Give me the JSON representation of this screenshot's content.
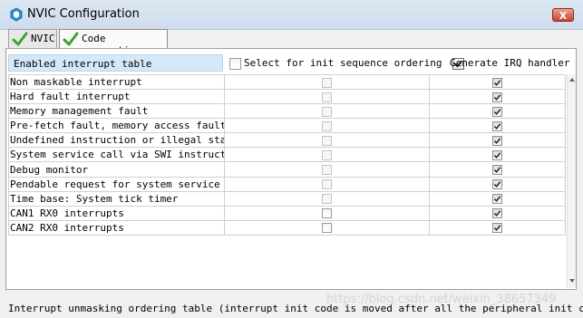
{
  "window": {
    "title": "NVIC Configuration",
    "close_label": "X"
  },
  "tabs": [
    {
      "label": "NVIC",
      "active": false
    },
    {
      "label": "Code generation",
      "active": true
    }
  ],
  "header": {
    "enabled_table_label": "Enabled interrupt table",
    "select_init_label": "Select for init sequence ordering",
    "select_init_checked": false,
    "generate_irq_label": "Generate IRQ handler",
    "generate_irq_checked": true
  },
  "rows": [
    {
      "name": "Non maskable interrupt",
      "init_seq": false,
      "init_enabled": false,
      "irq_handler": true
    },
    {
      "name": "Hard fault interrupt",
      "init_seq": false,
      "init_enabled": false,
      "irq_handler": true
    },
    {
      "name": "Memory management fault",
      "init_seq": false,
      "init_enabled": false,
      "irq_handler": true
    },
    {
      "name": "Pre-fetch fault, memory access fault",
      "init_seq": false,
      "init_enabled": false,
      "irq_handler": true
    },
    {
      "name": "Undefined instruction or illegal state",
      "init_seq": false,
      "init_enabled": false,
      "irq_handler": true
    },
    {
      "name": "System service call via SWI instruction",
      "init_seq": false,
      "init_enabled": false,
      "irq_handler": true
    },
    {
      "name": "Debug monitor",
      "init_seq": false,
      "init_enabled": false,
      "irq_handler": true
    },
    {
      "name": "Pendable request for system service",
      "init_seq": false,
      "init_enabled": false,
      "irq_handler": true
    },
    {
      "name": "Time base: System tick timer",
      "init_seq": false,
      "init_enabled": false,
      "irq_handler": true
    },
    {
      "name": "CAN1 RX0 interrupts",
      "init_seq": false,
      "init_enabled": true,
      "irq_handler": true
    },
    {
      "name": "CAN2 RX0 interrupts",
      "init_seq": false,
      "init_enabled": true,
      "irq_handler": true
    }
  ],
  "footer": {
    "text": "Interrupt unmasking ordering table (interrupt init code is moved after all the peripheral init code)"
  },
  "watermark": "https://blog.csdn.net/weixin_38657349",
  "colors": {
    "header_bg": "#d5e8f7",
    "titlebar": "#dde7f3",
    "close": "#c7432b",
    "check_green": "#3aa52a"
  }
}
